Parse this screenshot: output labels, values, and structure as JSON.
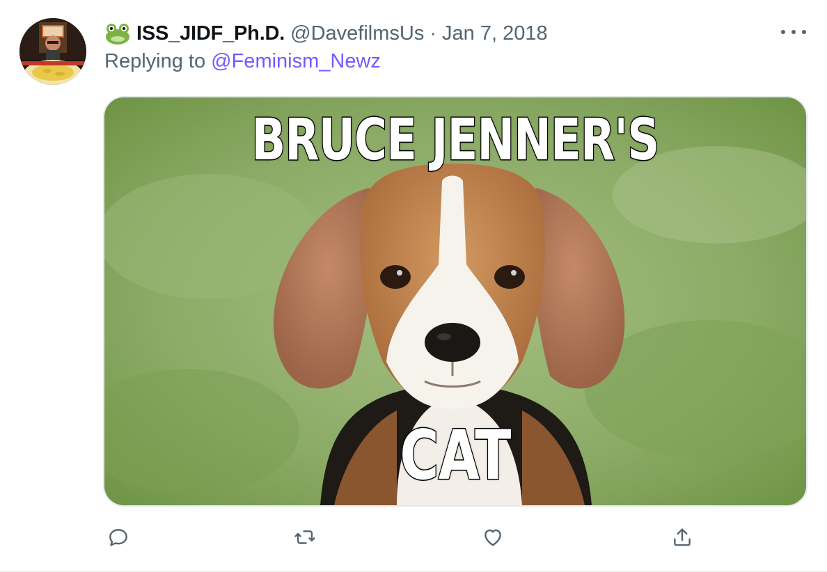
{
  "tweet": {
    "display_name": "ISS_JIDF_Ph.D.",
    "handle": "@DavefilmsUs",
    "separator": "·",
    "date": "Jan 7, 2018",
    "replying_prefix": "Replying to",
    "replying_to": "@Feminism_Newz",
    "name_emoji": "frog-icon"
  },
  "media": {
    "top_text": "BRUCE JENNER'S",
    "bottom_text": "CAT",
    "subject": "beagle puppy on green grass"
  },
  "actions": [
    {
      "name": "reply",
      "icon": "reply-icon"
    },
    {
      "name": "retweet",
      "icon": "retweet-icon"
    },
    {
      "name": "like",
      "icon": "like-icon"
    },
    {
      "name": "share",
      "icon": "share-icon"
    }
  ],
  "colors": {
    "text_primary": "#0f1419",
    "text_secondary": "#536471",
    "link": "#7856ff",
    "border": "#e1e8ed"
  }
}
